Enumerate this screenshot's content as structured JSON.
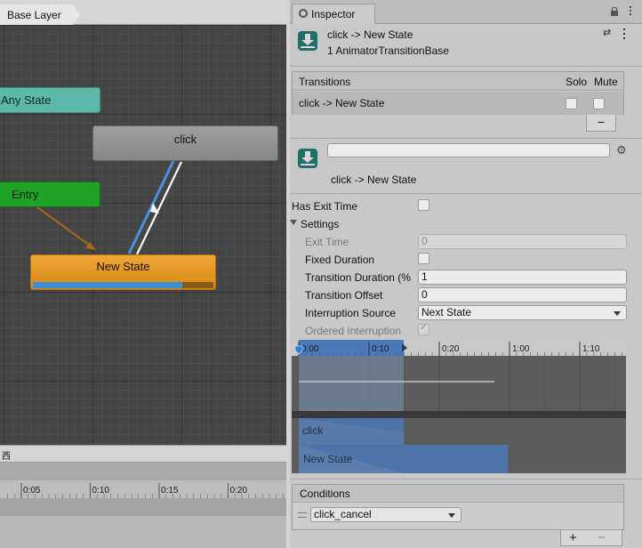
{
  "animator": {
    "breadcrumb": "Base Layer",
    "nodes": {
      "any_state": "Any State",
      "click": "click",
      "entry": "Entry",
      "new_state": "New State"
    },
    "new_state_progress": 0.83,
    "footer_text": "西",
    "bottom_ticks": [
      "0:05",
      "0:10",
      "0:15",
      "0:20"
    ]
  },
  "inspector": {
    "tab_title": "Inspector",
    "header": {
      "title": "click -> New State",
      "subtitle": "1 AnimatorTransitionBase"
    },
    "transitions": {
      "header": "Transitions",
      "solo_header": "Solo",
      "mute_header": "Mute",
      "rows": [
        {
          "label": "click -> New State",
          "solo": false,
          "mute": false
        }
      ],
      "remove_label": "−"
    },
    "transition": {
      "name_value": "",
      "title": "click -> New State"
    },
    "props": {
      "has_exit_time": {
        "label": "Has Exit Time",
        "checked": false
      },
      "settings": "Settings",
      "exit_time": {
        "label": "Exit Time",
        "value": "0"
      },
      "fixed_duration": {
        "label": "Fixed Duration",
        "checked": false
      },
      "transition_duration": {
        "label": "Transition Duration (%",
        "value": "1"
      },
      "transition_offset": {
        "label": "Transition Offset",
        "value": "0"
      },
      "interruption_source": {
        "label": "Interruption Source",
        "value": "Next State"
      },
      "ordered_interruption": {
        "label": "Ordered Interruption",
        "checked": true
      }
    },
    "timeline": {
      "ticks": [
        "0:00",
        "0:10",
        "0:20",
        "1:00",
        "1:10"
      ],
      "tracks": [
        "click",
        "New State"
      ]
    },
    "conditions": {
      "header": "Conditions",
      "items": [
        {
          "parameter": "click_cancel"
        }
      ],
      "add_label": "+",
      "remove_label": "−"
    }
  },
  "colors": {
    "any_state": "#5cb8a8",
    "entry": "#1ea327",
    "new_state": "#e8982a",
    "click_state": "#8f8f8f",
    "transition_blue": "#4a8fe0",
    "entry_arrow": "#a86a14",
    "timeline_highlight": "#4a78b8"
  },
  "icons": {
    "tab": "info-circle-icon",
    "lock": "lock-icon",
    "menu": "kebab-menu-icon",
    "preset": "sliders-icon",
    "transition": "transition-download-icon",
    "gear": "gear-icon"
  }
}
